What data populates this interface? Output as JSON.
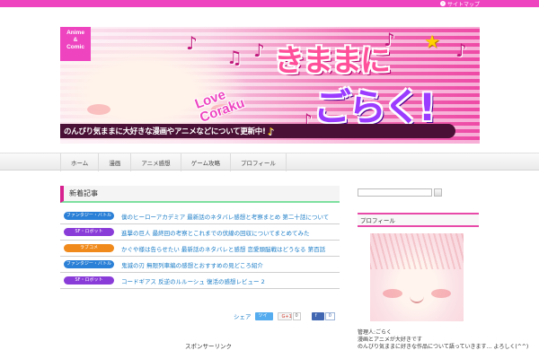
{
  "topbar": {
    "link_icon": "›",
    "link_text": "サイトマップ"
  },
  "banner": {
    "badge": [
      "Anime",
      "&",
      "Comic"
    ],
    "love_text": [
      "Love",
      "Coraku"
    ],
    "title_line1": "きままに",
    "title_line2": "ごらく!",
    "tagline": "のんびり気ままに大好きな漫画やアニメなどについて更新中!",
    "colors": {
      "pink": "#ee44c0",
      "purple": "#9a3bff",
      "tagline_bg": "#4a1035"
    }
  },
  "nav": {
    "items": [
      "ホーム",
      "漫画",
      "アニメ感想",
      "ゲーム攻略",
      "プロフィール"
    ]
  },
  "main": {
    "section_title": "新着記事",
    "posts": [
      {
        "category": "ファンタジー・バトル",
        "color": "#2a7fd6",
        "title": "僕のヒーローアカデミア 最新話のネタバレ感想と考察まとめ 第二十話について"
      },
      {
        "category": "SF・ロボット",
        "color": "#8a3cd8",
        "title": "進撃の巨人 最終回の考察とこれまでの伏線の回収についてまとめてみた"
      },
      {
        "category": "ラブコメ",
        "color": "#f08a1c",
        "title": "かぐや様は告らせたい 最新話のネタバレと感想 恋愛頭脳戦はどうなる 第百話"
      },
      {
        "category": "ファンタジー・バトル",
        "color": "#2a7fd6",
        "title": "鬼滅の刃 無限列車編の感想とおすすめの見どころ紹介"
      },
      {
        "category": "SF・ロボット",
        "color": "#8a3cd8",
        "title": "コードギアス 反逆のルルーシュ 復活の感想レビュー 2"
      }
    ],
    "share": {
      "label": "シェア",
      "twitter": "ツイート",
      "gplus": "G+1",
      "gplus_count": "0",
      "facebook": "f",
      "facebook_count": "0"
    },
    "footer_text": "スポンサーリンク"
  },
  "sidebar": {
    "search": {
      "placeholder": ""
    },
    "widget_title": "プロフィール",
    "profile_lines": [
      "管理人:ごらく",
      "漫画とアニメが大好きです",
      "のんびり気ままに好きな作品について語っていきます… よろしく(^^)"
    ]
  }
}
